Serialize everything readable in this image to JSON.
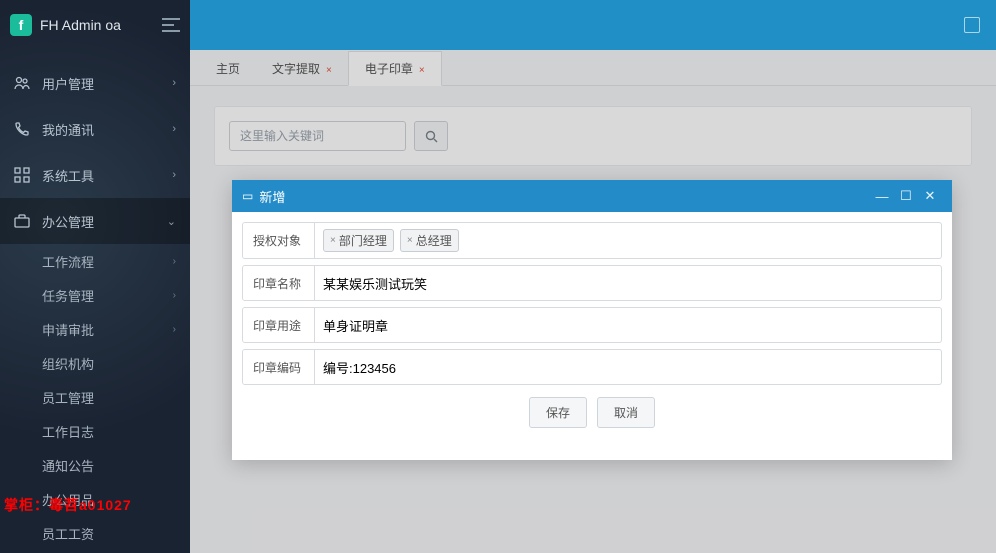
{
  "brand": "FH Admin oa",
  "nav": [
    {
      "icon": "users",
      "label": "用户管理",
      "chevron": true
    },
    {
      "icon": "phone",
      "label": "我的通讯",
      "chevron": true
    },
    {
      "icon": "grid",
      "label": "系统工具",
      "chevron": true
    },
    {
      "icon": "briefcase",
      "label": "办公管理",
      "chevron": true,
      "expanded": true
    }
  ],
  "subnav": [
    {
      "label": "工作流程",
      "chevron": true
    },
    {
      "label": "任务管理",
      "chevron": true
    },
    {
      "label": "申请审批",
      "chevron": true
    },
    {
      "label": "组织机构"
    },
    {
      "label": "员工管理"
    },
    {
      "label": "工作日志"
    },
    {
      "label": "通知公告"
    },
    {
      "label": "办公用品"
    },
    {
      "label": "员工工资"
    }
  ],
  "watermark": "掌柜：毒苕a01027",
  "tabs": [
    {
      "label": "主页",
      "closable": false,
      "active": false
    },
    {
      "label": "文字提取",
      "closable": true,
      "active": false
    },
    {
      "label": "电子印章",
      "closable": true,
      "active": true
    }
  ],
  "search": {
    "placeholder": "这里输入关键词"
  },
  "modal": {
    "title": "新增",
    "rows": {
      "auth": {
        "label": "授权对象",
        "tags": [
          "部门经理",
          "总经理"
        ]
      },
      "name": {
        "label": "印章名称",
        "value": "某某娱乐测试玩笑"
      },
      "purpose": {
        "label": "印章用途",
        "value": "单身证明章"
      },
      "code": {
        "label": "印章编码",
        "value": "编号:123456"
      }
    },
    "buttons": {
      "save": "保存",
      "cancel": "取消"
    }
  }
}
